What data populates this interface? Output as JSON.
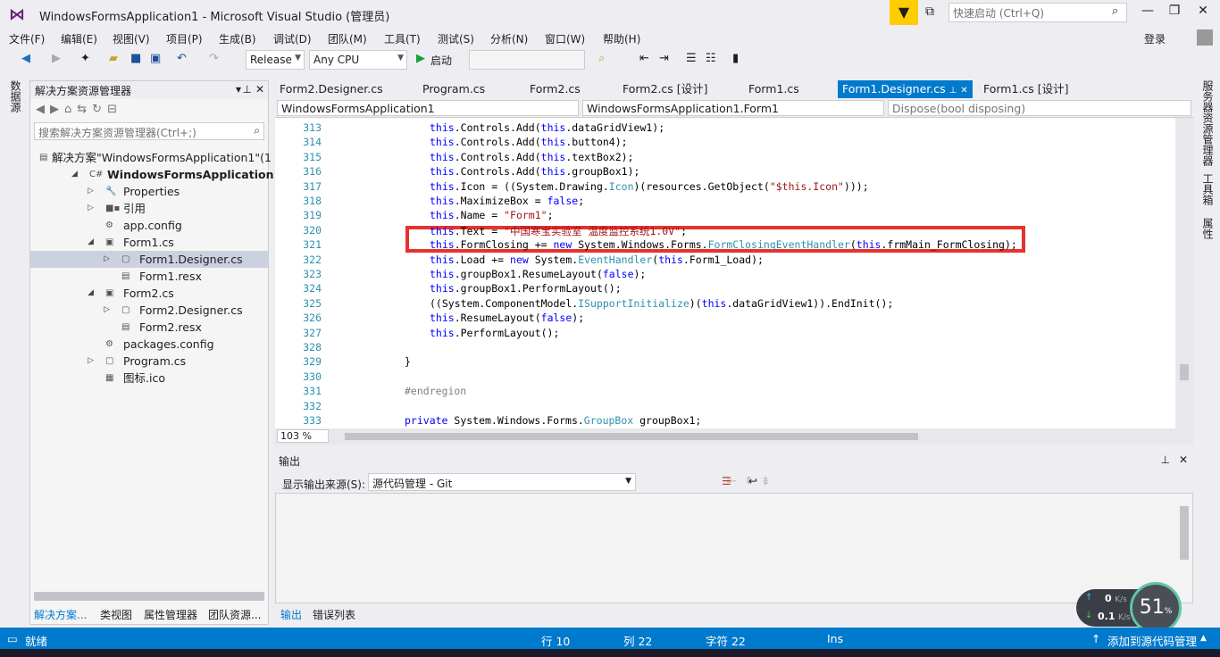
{
  "window": {
    "title": "WindowsFormsApplication1 - Microsoft Visual Studio (管理员)",
    "quick_launch_placeholder": "快速启动 (Ctrl+Q)",
    "login": "登录"
  },
  "menu": [
    "文件(F)",
    "编辑(E)",
    "视图(V)",
    "项目(P)",
    "生成(B)",
    "调试(D)",
    "团队(M)",
    "工具(T)",
    "测试(S)",
    "分析(N)",
    "窗口(W)",
    "帮助(H)"
  ],
  "toolbar": {
    "configuration": "Release",
    "platform": "Any CPU",
    "start_label": "启动"
  },
  "left_side_tabs": [
    "数据源"
  ],
  "right_side_tabs": [
    "服务器资源管理器",
    "工具箱",
    "属性"
  ],
  "solution_explorer": {
    "title": "解决方案资源管理器",
    "search_placeholder": "搜索解决方案资源管理器(Ctrl+;)",
    "items": [
      {
        "label": "解决方案\"WindowsFormsApplication1\"(1",
        "icon": "solution-icon"
      },
      {
        "label": "WindowsFormsApplication1",
        "icon": "csharp-project-icon"
      },
      {
        "label": "Properties",
        "icon": "wrench-icon"
      },
      {
        "label": "引用",
        "icon": "references-icon"
      },
      {
        "label": "app.config",
        "icon": "config-icon"
      },
      {
        "label": "Form1.cs",
        "icon": "form-icon"
      },
      {
        "label": "Form1.Designer.cs",
        "icon": "cs-file-icon",
        "selected": true
      },
      {
        "label": "Form1.resx",
        "icon": "resx-icon"
      },
      {
        "label": "Form2.cs",
        "icon": "form-icon"
      },
      {
        "label": "Form2.Designer.cs",
        "icon": "cs-file-icon"
      },
      {
        "label": "Form2.resx",
        "icon": "resx-icon"
      },
      {
        "label": "packages.config",
        "icon": "config-icon"
      },
      {
        "label": "Program.cs",
        "icon": "cs-file-icon"
      },
      {
        "label": "图标.ico",
        "icon": "ico-file-icon"
      }
    ],
    "bottom_tabs": [
      "解决方案...",
      "类视图",
      "属性管理器",
      "团队资源..."
    ]
  },
  "editor": {
    "tabs": [
      "Form2.Designer.cs",
      "Program.cs",
      "Form2.cs",
      "Form2.cs [设计]",
      "Form1.cs",
      "Form1.Designer.cs",
      "Form1.cs [设计]"
    ],
    "active_tab": "Form1.Designer.cs",
    "nav": {
      "project": "WindowsFormsApplication1",
      "class": "WindowsFormsApplication1.Form1",
      "member": "Dispose(bool disposing)"
    },
    "zoom": "103 %",
    "lines": [
      {
        "n": "313",
        "indent": 2,
        "tokens": [
          [
            "kw",
            "this"
          ],
          [
            "",
            "."
          ],
          [
            "",
            "Controls.Add("
          ],
          [
            "kw",
            "this"
          ],
          [
            "",
            ".dataGridView1);"
          ]
        ]
      },
      {
        "n": "314",
        "indent": 2,
        "tokens": [
          [
            "kw",
            "this"
          ],
          [
            "",
            ".Controls.Add("
          ],
          [
            "kw",
            "this"
          ],
          [
            "",
            ".button4);"
          ]
        ]
      },
      {
        "n": "315",
        "indent": 2,
        "tokens": [
          [
            "kw",
            "this"
          ],
          [
            "",
            ".Controls.Add("
          ],
          [
            "kw",
            "this"
          ],
          [
            "",
            ".textBox2);"
          ]
        ]
      },
      {
        "n": "316",
        "indent": 2,
        "tokens": [
          [
            "kw",
            "this"
          ],
          [
            "",
            ".Controls.Add("
          ],
          [
            "kw",
            "this"
          ],
          [
            "",
            ".groupBox1);"
          ]
        ]
      },
      {
        "n": "317",
        "indent": 2,
        "tokens": [
          [
            "kw",
            "this"
          ],
          [
            "",
            ".Icon = ((System.Drawing."
          ],
          [
            "ty",
            "Icon"
          ],
          [
            "",
            ")(resources.GetObject("
          ],
          [
            "st",
            "\"$this.Icon\""
          ],
          [
            "",
            ")));"
          ]
        ]
      },
      {
        "n": "318",
        "indent": 2,
        "tokens": [
          [
            "kw",
            "this"
          ],
          [
            "",
            ".MaximizeBox = "
          ],
          [
            "kw",
            "false"
          ],
          [
            "",
            ";"
          ]
        ]
      },
      {
        "n": "319",
        "indent": 2,
        "tokens": [
          [
            "kw",
            "this"
          ],
          [
            "",
            ".Name = "
          ],
          [
            "st",
            "\"Form1\""
          ],
          [
            "",
            ";"
          ]
        ]
      },
      {
        "n": "320",
        "indent": 2,
        "tokens": [
          [
            "kw",
            "this"
          ],
          [
            "",
            ".Text = "
          ],
          [
            "st",
            "\"中国寒宝实验室 温度监控系统1.0V\""
          ],
          [
            "",
            ";"
          ]
        ]
      },
      {
        "n": "321",
        "indent": 2,
        "tokens": [
          [
            "kw",
            "this"
          ],
          [
            "",
            ".FormClosing += "
          ],
          [
            "kw",
            "new"
          ],
          [
            "",
            " System.Windows.Forms."
          ],
          [
            "ty",
            "FormClosingEventHandler"
          ],
          [
            "",
            "("
          ],
          [
            "kw",
            "this"
          ],
          [
            "",
            ".frmMain_FormClosing);"
          ]
        ]
      },
      {
        "n": "322",
        "indent": 2,
        "tokens": [
          [
            "kw",
            "this"
          ],
          [
            "",
            ".Load += "
          ],
          [
            "kw",
            "new"
          ],
          [
            "",
            " System."
          ],
          [
            "ty",
            "EventHandler"
          ],
          [
            "",
            "("
          ],
          [
            "kw",
            "this"
          ],
          [
            "",
            ".Form1_Load);"
          ]
        ]
      },
      {
        "n": "323",
        "indent": 2,
        "tokens": [
          [
            "kw",
            "this"
          ],
          [
            "",
            ".groupBox1.ResumeLayout("
          ],
          [
            "kw",
            "false"
          ],
          [
            "",
            ");"
          ]
        ]
      },
      {
        "n": "324",
        "indent": 2,
        "tokens": [
          [
            "kw",
            "this"
          ],
          [
            "",
            ".groupBox1.PerformLayout();"
          ]
        ]
      },
      {
        "n": "325",
        "indent": 2,
        "tokens": [
          [
            "",
            "((System.ComponentModel."
          ],
          [
            "ty",
            "ISupportInitialize"
          ],
          [
            "",
            ")("
          ],
          [
            "kw",
            "this"
          ],
          [
            "",
            ".dataGridView1)).EndInit();"
          ]
        ]
      },
      {
        "n": "326",
        "indent": 2,
        "tokens": [
          [
            "kw",
            "this"
          ],
          [
            "",
            ".ResumeLayout("
          ],
          [
            "kw",
            "false"
          ],
          [
            "",
            ");"
          ]
        ]
      },
      {
        "n": "327",
        "indent": 2,
        "tokens": [
          [
            "kw",
            "this"
          ],
          [
            "",
            ".PerformLayout();"
          ]
        ]
      },
      {
        "n": "328",
        "indent": 2,
        "tokens": []
      },
      {
        "n": "329",
        "indent": 1,
        "tokens": [
          [
            "",
            "}"
          ]
        ]
      },
      {
        "n": "330",
        "indent": 1,
        "tokens": []
      },
      {
        "n": "331",
        "indent": 1,
        "tokens": [
          [
            "pp",
            "#endregion"
          ]
        ]
      },
      {
        "n": "332",
        "indent": 1,
        "tokens": []
      },
      {
        "n": "333",
        "indent": 1,
        "tokens": [
          [
            "kw",
            "private"
          ],
          [
            "",
            " System.Windows.Forms."
          ],
          [
            "ty",
            "GroupBox"
          ],
          [
            "",
            " groupBox1;"
          ]
        ]
      }
    ]
  },
  "output": {
    "title": "输出",
    "source_label": "显示输出来源(S):",
    "source_value": "源代码管理 - Git",
    "tabs": [
      "输出",
      "错误列表"
    ]
  },
  "statusbar": {
    "ready": "就绪",
    "line": "行 10",
    "col": "列 22",
    "char": "字符 22",
    "mode": "Ins",
    "source_control": "添加到源代码管理"
  },
  "network_widget": {
    "upload": "0",
    "download": "0.1",
    "unit": "K/s",
    "cpu_percent": "51",
    "percent_sign": "%"
  },
  "colors": {
    "accent": "#007acc",
    "highlight_box": "#e8322e",
    "vs_purple": "#68217a"
  }
}
